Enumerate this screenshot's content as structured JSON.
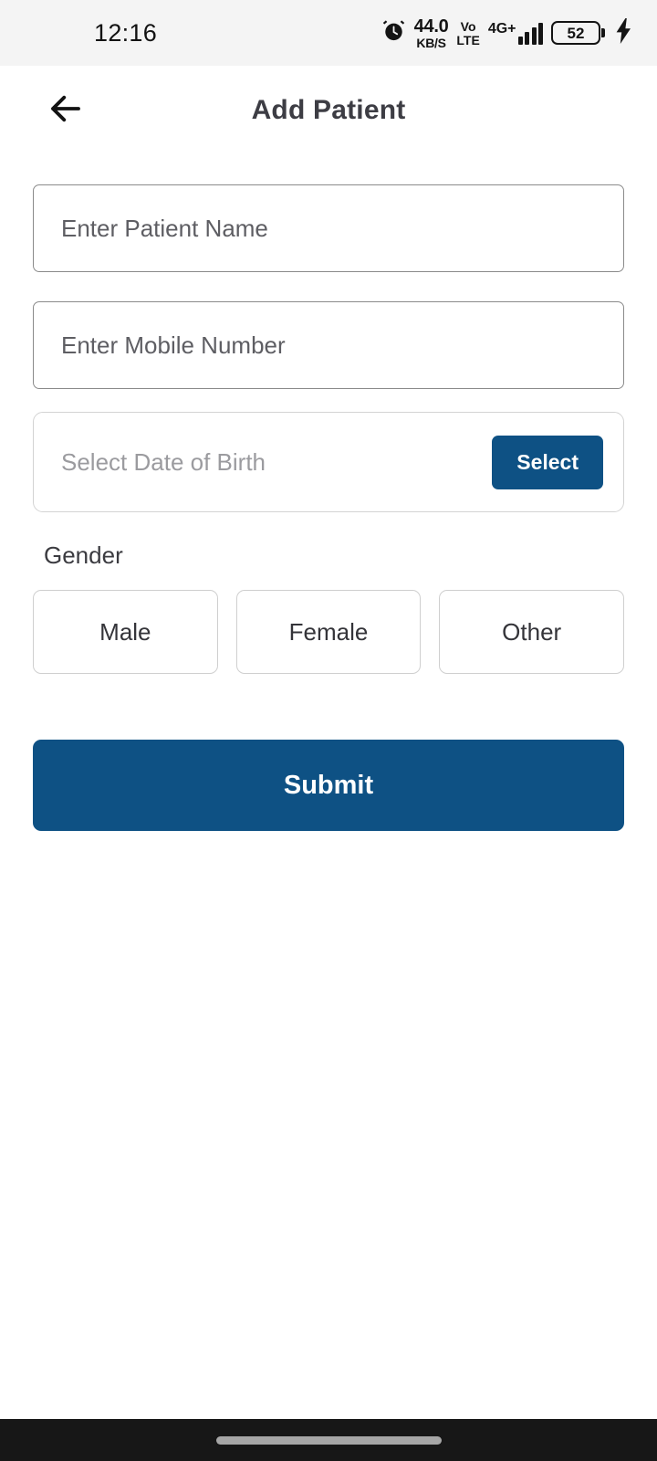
{
  "status_bar": {
    "time": "12:16",
    "alarm_icon": "alarm-clock-icon",
    "network_speed_value": "44.0",
    "network_speed_unit": "KB/S",
    "volte_line1": "Vo",
    "volte_line2": "LTE",
    "network_type": "4G+",
    "signal_icon": "signal-bars-icon",
    "battery_level": "52",
    "charging_icon": "charging-bolt-icon"
  },
  "header": {
    "back_icon": "back-arrow-icon",
    "title": "Add Patient"
  },
  "form": {
    "patient_name": {
      "placeholder": "Enter Patient Name",
      "value": ""
    },
    "mobile_number": {
      "placeholder": "Enter Mobile Number",
      "value": ""
    },
    "date_of_birth": {
      "placeholder": "Select Date of Birth",
      "value": "",
      "button_label": "Select"
    },
    "gender": {
      "label": "Gender",
      "options": [
        {
          "label": "Male",
          "selected": false
        },
        {
          "label": "Female",
          "selected": false
        },
        {
          "label": "Other",
          "selected": false
        }
      ]
    },
    "submit_label": "Submit"
  },
  "nav_bar": {
    "home_indicator": "home-indicator"
  },
  "colors": {
    "primary_blue": "#0e5184",
    "status_bar_bg": "#f4f4f4",
    "nav_bar_bg": "#171717",
    "field_border": "#8b8b8b",
    "light_border": "#cfcfcf",
    "title_text": "#3d3d44"
  }
}
